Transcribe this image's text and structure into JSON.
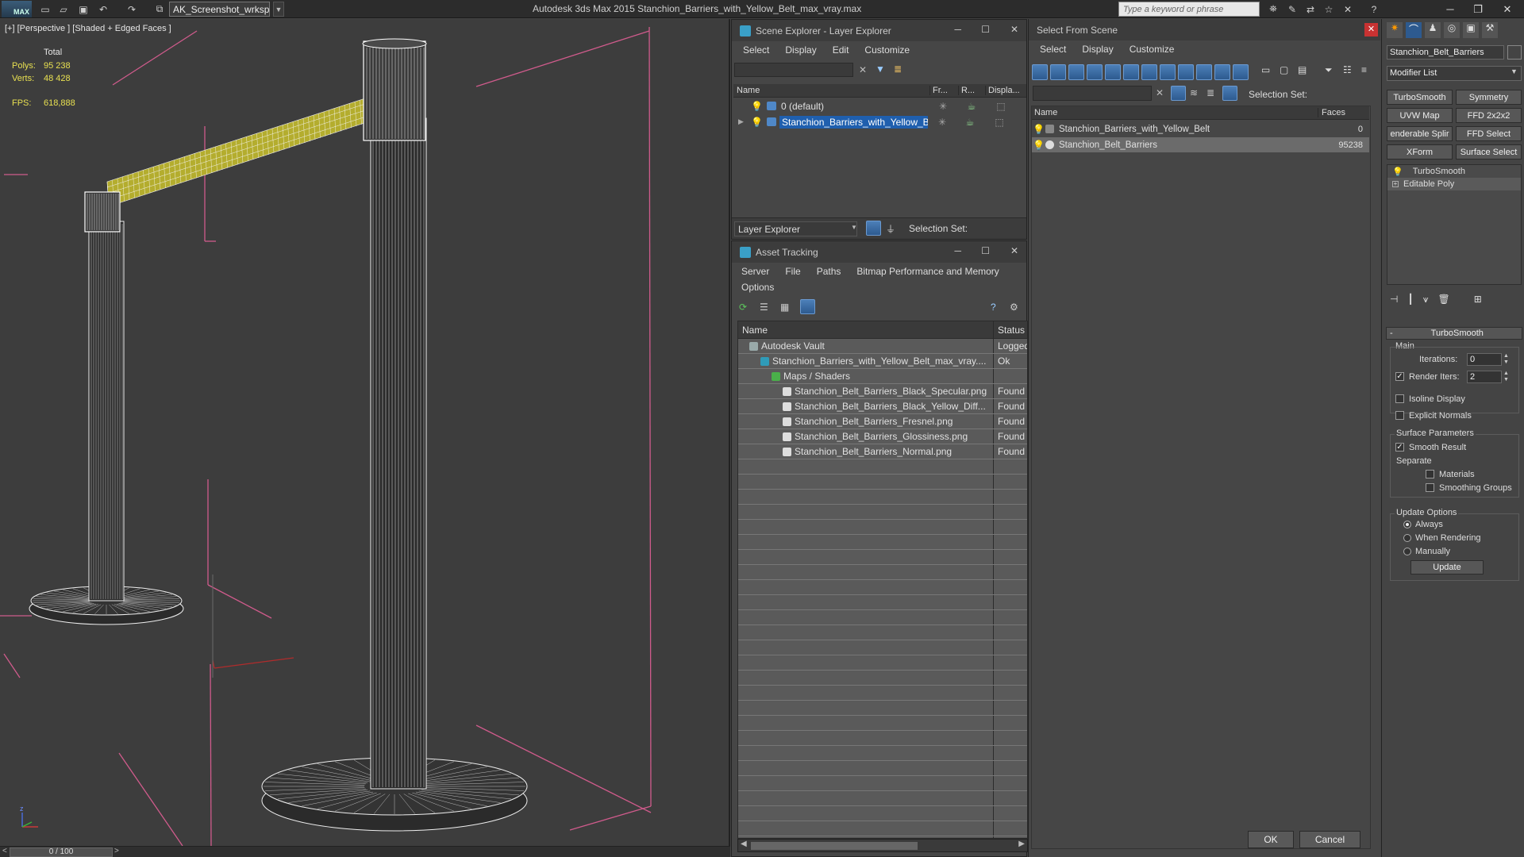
{
  "app": {
    "logo_text": "MAX",
    "workspace": "AK_Screenshot_wrksp",
    "title": "Autodesk 3ds Max  2015     Stanchion_Barriers_with_Yellow_Belt_max_vray.max",
    "search_placeholder": "Type a keyword or phrase"
  },
  "viewport": {
    "label": "[+] [Perspective ] [Shaded + Edged Faces ]",
    "stats": {
      "total_label": "Total",
      "polys_label": "Polys:",
      "polys_value": "95 238",
      "verts_label": "Verts:",
      "verts_value": "48 428",
      "fps_label": "FPS:",
      "fps_value": "618,888"
    },
    "axis_labels": {
      "x": "x",
      "y": "y",
      "z": "z"
    }
  },
  "timeslider": {
    "value": "0 / 100",
    "left_arrow": "<",
    "right_arrow": ">"
  },
  "scene_explorer": {
    "title": "Scene Explorer - Layer Explorer",
    "menu": [
      "Select",
      "Display",
      "Edit",
      "Customize"
    ],
    "columns": [
      "Name",
      "Fr...",
      "R...",
      "Displa..."
    ],
    "rows": [
      {
        "name": "0 (default)",
        "selected": false
      },
      {
        "name": "Stanchion_Barriers_with_Yellow_Belt",
        "selected": true
      }
    ],
    "footer_mode": "Layer Explorer",
    "footer_selection": "Selection Set:"
  },
  "asset_tracking": {
    "title": "Asset Tracking",
    "menu": [
      "Server",
      "File",
      "Paths",
      "Bitmap Performance and Memory"
    ],
    "menu2": [
      "Options"
    ],
    "columns": [
      "Name",
      "Status"
    ],
    "rows": [
      {
        "name": "Autodesk Vault",
        "status": "Logged",
        "indent": 1
      },
      {
        "name": "Stanchion_Barriers_with_Yellow_Belt_max_vray....",
        "status": "Ok",
        "indent": 2
      },
      {
        "name": "Maps / Shaders",
        "status": "",
        "indent": 3
      },
      {
        "name": "Stanchion_Belt_Barriers_Black_Specular.png",
        "status": "Found",
        "indent": 4
      },
      {
        "name": "Stanchion_Belt_Barriers_Black_Yellow_Diff...",
        "status": "Found",
        "indent": 4
      },
      {
        "name": "Stanchion_Belt_Barriers_Fresnel.png",
        "status": "Found",
        "indent": 4
      },
      {
        "name": "Stanchion_Belt_Barriers_Glossiness.png",
        "status": "Found",
        "indent": 4
      },
      {
        "name": "Stanchion_Belt_Barriers_Normal.png",
        "status": "Found",
        "indent": 4
      }
    ]
  },
  "select_from_scene": {
    "title": "Select From Scene",
    "menu": [
      "Select",
      "Display",
      "Customize"
    ],
    "selection_set_label": "Selection Set:",
    "columns": [
      "Name",
      "Faces"
    ],
    "rows": [
      {
        "name": "Stanchion_Barriers_with_Yellow_Belt",
        "faces": "0",
        "selected": false
      },
      {
        "name": "Stanchion_Belt_Barriers",
        "faces": "95238",
        "selected": true
      }
    ],
    "ok_label": "OK",
    "cancel_label": "Cancel"
  },
  "command_panel": {
    "object_name": "Stanchion_Belt_Barriers",
    "modifier_list": "Modifier List",
    "buttons": [
      "TurboSmooth",
      "Symmetry",
      "UVW Map",
      "FFD 2x2x2",
      "enderable Splir",
      "FFD Select",
      "XForm",
      "Surface Select"
    ],
    "stack": [
      "TurboSmooth",
      "Editable Poly"
    ],
    "rollout_title": "TurboSmooth",
    "main_label": "Main",
    "iterations_label": "Iterations:",
    "iterations_value": "0",
    "render_iters_label": "Render Iters:",
    "render_iters_value": "2",
    "isoline_label": "Isoline Display",
    "explicit_normals_label": "Explicit Normals",
    "surface_params_label": "Surface Parameters",
    "smooth_result_label": "Smooth Result",
    "separate_label": "Separate",
    "materials_label": "Materials",
    "smoothing_groups_label": "Smoothing Groups",
    "update_options_label": "Update Options",
    "always_label": "Always",
    "when_rendering_label": "When Rendering",
    "manually_label": "Manually",
    "update_button": "Update"
  }
}
